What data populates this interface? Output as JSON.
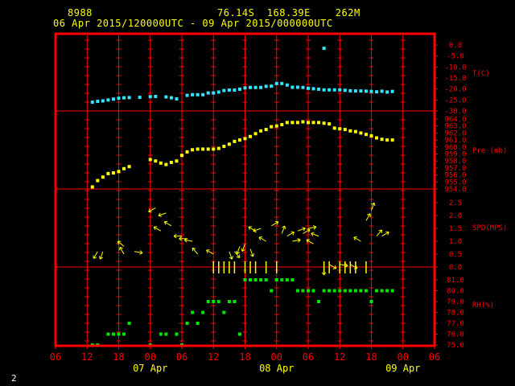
{
  "header": {
    "station": "8988",
    "location": "76.14S  168.39E    262M",
    "period": "06 Apr 2015/120000UTC - 09 Apr 2015/000000UTC"
  },
  "page_number": "2",
  "colors": {
    "frame": "#ff0000",
    "temperature": "#33e6ff",
    "pressure": "#ffff00",
    "wind": "#ffff00",
    "humidity": "#00e600",
    "labels": "#ff0000",
    "time_labels": "#ffff00"
  },
  "chart_data": {
    "type": "scatter",
    "x_unit": "hours since 06 Apr 2015 00UTC",
    "x_ticks": [
      "06",
      "12",
      "18",
      "00",
      "06",
      "12",
      "18",
      "00",
      "06",
      "12",
      "18",
      "00",
      "06"
    ],
    "x_tick_values": [
      6,
      12,
      18,
      24,
      30,
      36,
      42,
      48,
      54,
      60,
      66,
      72,
      78
    ],
    "date_labels": [
      {
        "text": "07 Apr",
        "x": 24
      },
      {
        "text": "08 Apr",
        "x": 48
      },
      {
        "text": "09 Apr",
        "x": 72
      }
    ],
    "panels": [
      {
        "name": "T(C)",
        "ylim": [
          -30,
          0
        ],
        "ticks": [
          0,
          -5,
          -10,
          -15,
          -20,
          -25,
          -30
        ],
        "tick_labels": [
          "0.0",
          "-5.0",
          "-10.0",
          "-15.0",
          "-20.0",
          "-25.0",
          "-30.0"
        ],
        "points": [
          [
            13,
            -26
          ],
          [
            14,
            -25.6
          ],
          [
            15,
            -25.4
          ],
          [
            16,
            -25
          ],
          [
            17,
            -24.6
          ],
          [
            18,
            -24.2
          ],
          [
            19,
            -24
          ],
          [
            20,
            -23.9
          ],
          [
            22,
            -23.8
          ],
          [
            24,
            -23.5
          ],
          [
            25,
            -23.4
          ],
          [
            27,
            -23.6
          ],
          [
            28,
            -24
          ],
          [
            29,
            -24.5
          ],
          [
            31,
            -22.9
          ],
          [
            32,
            -22.6
          ],
          [
            33,
            -22.6
          ],
          [
            34,
            -22.6
          ],
          [
            35,
            -21.8
          ],
          [
            36,
            -21.8
          ],
          [
            37,
            -21.4
          ],
          [
            38,
            -20.7
          ],
          [
            39,
            -20.5
          ],
          [
            40,
            -20.5
          ],
          [
            41,
            -20.1
          ],
          [
            42,
            -19.5
          ],
          [
            43,
            -19.3
          ],
          [
            44,
            -19.3
          ],
          [
            45,
            -19.3
          ],
          [
            46,
            -18.8
          ],
          [
            47,
            -18.7
          ],
          [
            48,
            -17.5
          ],
          [
            49,
            -17.5
          ],
          [
            50,
            -18.2
          ],
          [
            51,
            -19.2
          ],
          [
            52,
            -19.2
          ],
          [
            53,
            -19.3
          ],
          [
            54,
            -19.7
          ],
          [
            55,
            -19.9
          ],
          [
            56,
            -20.1
          ],
          [
            57,
            -20.4
          ],
          [
            58,
            -20.4
          ],
          [
            59,
            -20.4
          ],
          [
            60,
            -20.4
          ],
          [
            61,
            -20.6
          ],
          [
            62,
            -20.8
          ],
          [
            63,
            -20.9
          ],
          [
            64,
            -20.9
          ],
          [
            65,
            -21
          ],
          [
            66,
            -21.1
          ],
          [
            67,
            -21.3
          ],
          [
            68,
            -21
          ],
          [
            69,
            -21.4
          ],
          [
            70,
            -21.1
          ],
          [
            57,
            -1.5
          ]
        ]
      },
      {
        "name": "Pre (mb)",
        "ylim": [
          954,
          965
        ],
        "ticks": [
          954,
          955,
          956,
          957,
          958,
          959,
          960,
          961,
          962,
          963,
          964
        ],
        "tick_labels": [
          "954.0",
          "955.0",
          "956.0",
          "957.0",
          "958.0",
          "959.0",
          "960.0",
          "961.0",
          "962.0",
          "963.0",
          "964.0"
        ],
        "points": [
          [
            13,
            954.3
          ],
          [
            14,
            955.2
          ],
          [
            15,
            955.7
          ],
          [
            16,
            956.2
          ],
          [
            17,
            956.3
          ],
          [
            18,
            956.5
          ],
          [
            19,
            956.9
          ],
          [
            20,
            957.2
          ],
          [
            24,
            958.2
          ],
          [
            25,
            958
          ],
          [
            26,
            957.7
          ],
          [
            27,
            957.5
          ],
          [
            28,
            957.8
          ],
          [
            29,
            958
          ],
          [
            30,
            958.8
          ],
          [
            31,
            959.3
          ],
          [
            32,
            959.6
          ],
          [
            33,
            959.7
          ],
          [
            34,
            959.7
          ],
          [
            35,
            959.7
          ],
          [
            36,
            959.7
          ],
          [
            37,
            959.8
          ],
          [
            38,
            960.1
          ],
          [
            39,
            960.4
          ],
          [
            40,
            960.8
          ],
          [
            41,
            961
          ],
          [
            42,
            961.2
          ],
          [
            43,
            961.5
          ],
          [
            44,
            961.9
          ],
          [
            45,
            962.3
          ],
          [
            46,
            962.5
          ],
          [
            47,
            962.9
          ],
          [
            48,
            963
          ],
          [
            49,
            963.2
          ],
          [
            50,
            963.5
          ],
          [
            51,
            963.5
          ],
          [
            52,
            963.5
          ],
          [
            53,
            963.6
          ],
          [
            54,
            963.5
          ],
          [
            55,
            963.5
          ],
          [
            56,
            963.5
          ],
          [
            57,
            963.4
          ],
          [
            58,
            963.3
          ],
          [
            59,
            962.7
          ],
          [
            60,
            962.6
          ],
          [
            61,
            962.5
          ],
          [
            62,
            962.3
          ],
          [
            63,
            962.2
          ],
          [
            64,
            962
          ],
          [
            65,
            961.8
          ],
          [
            66,
            961.6
          ],
          [
            67,
            961.3
          ],
          [
            68,
            961.1
          ],
          [
            69,
            961
          ],
          [
            70,
            961
          ]
        ]
      },
      {
        "name": "SPD(MPS)",
        "ylim": [
          0,
          3
        ],
        "ticks": [
          0,
          0.5,
          1,
          1.5,
          2,
          2.5
        ],
        "tick_labels": [
          "0.0",
          "0.5",
          "1.0",
          "1.5",
          "2.0",
          "2.5"
        ],
        "wind": [
          [
            14,
            0.6,
            210
          ],
          [
            15,
            0.6,
            200
          ],
          [
            18,
            1
          ],
          [
            19,
            0.8,
            310
          ],
          [
            19,
            0.5,
            330
          ],
          [
            21,
            0.6,
            100
          ],
          [
            24,
            2
          ],
          [
            25,
            2.3,
            240
          ],
          [
            26,
            1.4,
            300
          ],
          [
            28,
            1.6,
            300
          ],
          [
            27,
            2.1,
            250
          ],
          [
            30,
            1.2,
            270
          ],
          [
            31,
            1.1,
            270
          ],
          [
            32,
            1,
            280
          ],
          [
            33,
            0.5,
            320
          ],
          [
            36,
            0.5,
            300
          ],
          [
            39,
            0.6,
            160
          ],
          [
            40,
            0.6,
            140
          ],
          [
            41,
            0.8,
            200
          ],
          [
            42,
            0.9,
            200
          ],
          [
            43,
            0.7,
            160
          ],
          [
            44,
            1.4,
            300
          ],
          [
            45,
            1.5,
            250
          ],
          [
            46,
            1,
            300
          ],
          [
            47,
            1.6,
            60
          ],
          [
            49,
            1.3,
            20
          ],
          [
            50,
            1.2,
            60
          ],
          [
            51,
            1,
            80
          ],
          [
            52,
            1.4,
            70
          ],
          [
            53,
            1.3,
            60
          ],
          [
            54,
            1.5,
            80
          ],
          [
            55,
            0.9,
            300
          ],
          [
            56,
            1.2,
            290
          ],
          [
            57,
            0,
            180
          ],
          [
            58,
            0.1,
            120
          ],
          [
            60,
            0.1,
            100
          ],
          [
            62,
            0.1,
            120
          ],
          [
            64,
            1,
            300
          ],
          [
            65,
            1.8,
            30
          ],
          [
            66,
            2.2,
            20
          ],
          [
            67,
            1.2,
            40
          ],
          [
            68,
            1.2,
            60
          ]
        ],
        "calm_x": [
          36,
          37,
          38,
          39,
          40,
          42,
          43,
          44,
          46,
          48,
          57,
          58,
          60,
          61,
          62,
          63,
          65
        ]
      },
      {
        "name": "RH(%)",
        "ylim": [
          75,
          82
        ],
        "ticks": [
          75,
          76,
          77,
          78,
          79,
          80,
          81
        ],
        "tick_labels": [
          "75.0",
          "76.0",
          "77.0",
          "78.0",
          "79.0",
          "80.0",
          "81.0"
        ],
        "points": [
          [
            13,
            75
          ],
          [
            14,
            75
          ],
          [
            16,
            76
          ],
          [
            17,
            76
          ],
          [
            18,
            76
          ],
          [
            19,
            76
          ],
          [
            20,
            77
          ],
          [
            24,
            75
          ],
          [
            26,
            76
          ],
          [
            27,
            76
          ],
          [
            29,
            76
          ],
          [
            30,
            75
          ],
          [
            31,
            77
          ],
          [
            32,
            78
          ],
          [
            33,
            77
          ],
          [
            34,
            78
          ],
          [
            35,
            79
          ],
          [
            36,
            79
          ],
          [
            37,
            79
          ],
          [
            38,
            78
          ],
          [
            39,
            79
          ],
          [
            40,
            79
          ],
          [
            42,
            81
          ],
          [
            43,
            81
          ],
          [
            44,
            81
          ],
          [
            45,
            81
          ],
          [
            46,
            81
          ],
          [
            47,
            80
          ],
          [
            48,
            81
          ],
          [
            49,
            81
          ],
          [
            50,
            81
          ],
          [
            51,
            81
          ],
          [
            52,
            80
          ],
          [
            53,
            80
          ],
          [
            54,
            80
          ],
          [
            55,
            80
          ],
          [
            56,
            79
          ],
          [
            57,
            80
          ],
          [
            58,
            80
          ],
          [
            59,
            80
          ],
          [
            60,
            80
          ],
          [
            61,
            80
          ],
          [
            62,
            80
          ],
          [
            63,
            80
          ],
          [
            64,
            80
          ],
          [
            65,
            80
          ],
          [
            66,
            79
          ],
          [
            67,
            80
          ],
          [
            68,
            80
          ],
          [
            69,
            80
          ],
          [
            70,
            80
          ],
          [
            41,
            76
          ]
        ]
      }
    ]
  }
}
